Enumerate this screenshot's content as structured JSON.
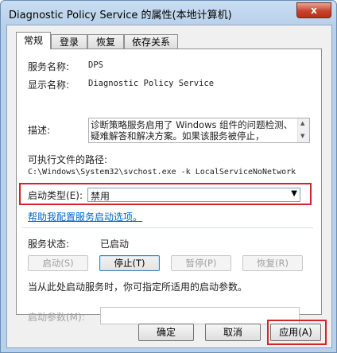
{
  "window": {
    "title": "Diagnostic Policy Service 的属性(本地计算机)",
    "close_label": "x"
  },
  "tabs": [
    {
      "label": "常规"
    },
    {
      "label": "登录"
    },
    {
      "label": "恢复"
    },
    {
      "label": "依存关系"
    }
  ],
  "general": {
    "service_name_label": "服务名称:",
    "service_name_value": "DPS",
    "display_name_label": "显示名称:",
    "display_name_value": "Diagnostic Policy Service",
    "description_label": "描述:",
    "description_value": "诊断策略服务启用了 Windows 组件的问题检测、疑难解答和解决方案。如果该服务被停止，",
    "exec_path_label": "可执行文件的路径:",
    "exec_path_value": "C:\\Windows\\System32\\svchost.exe -k LocalServiceNoNetwork",
    "startup_type_label": "启动类型(E):",
    "startup_type_value": "禁用",
    "help_link": "帮助我配置服务启动选项。",
    "status_label": "服务状态:",
    "status_value": "已启动",
    "start_button": "启动(S)",
    "stop_button": "停止(T)",
    "pause_button": "暂停(P)",
    "resume_button": "恢复(R)",
    "hint_text": "当从此处启动服务时，你可指定所适用的启动参数。",
    "start_params_label": "启动参数(M):",
    "start_params_value": ""
  },
  "footer": {
    "ok_button": "确定",
    "cancel_button": "取消",
    "apply_button": "应用(A)"
  },
  "colors": {
    "highlight": "#d3232d",
    "link": "#0066cc"
  }
}
